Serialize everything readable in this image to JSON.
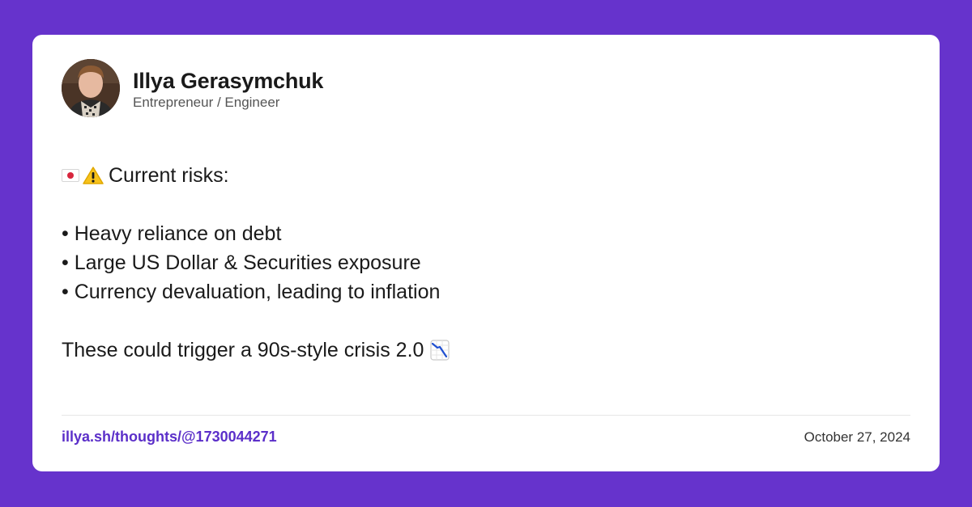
{
  "colors": {
    "background": "#6633cc",
    "card": "#ffffff",
    "link": "#5b2fc9"
  },
  "author": {
    "name": "Illya Gerasymchuk",
    "role": "Entrepreneur / Engineer",
    "avatar_icon": "user-avatar"
  },
  "post": {
    "heading_icons": [
      "japan-flag-icon",
      "warning-icon"
    ],
    "heading": "Current risks:",
    "bullets": [
      "• Heavy reliance on debt",
      "• Large US Dollar & Securities exposure",
      "• Currency devaluation, leading to inflation"
    ],
    "closing": "These could trigger a 90s-style crisis 2.0",
    "closing_icon": "chart-decreasing-icon"
  },
  "footer": {
    "link": "illya.sh/thoughts/@1730044271",
    "date": "October 27, 2024"
  }
}
